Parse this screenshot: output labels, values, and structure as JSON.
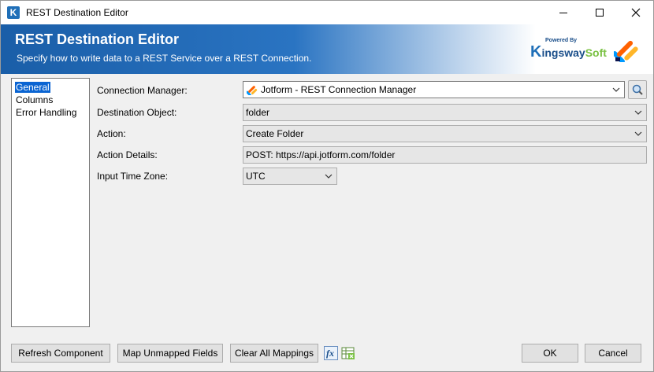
{
  "window": {
    "title": "REST Destination Editor",
    "icon": "kingsway-app-icon"
  },
  "header": {
    "title": "REST Destination Editor",
    "subtitle": "Specify how to write data to a REST Service over a REST Connection.",
    "brand_powered_by": "Powered By",
    "brand_k": "K",
    "brand_ingsway": "ingsway",
    "brand_soft": "Soft"
  },
  "nav": {
    "items": [
      {
        "label": "General",
        "selected": true
      },
      {
        "label": "Columns",
        "selected": false
      },
      {
        "label": "Error Handling",
        "selected": false
      }
    ]
  },
  "form": {
    "connection_manager": {
      "label": "Connection Manager:",
      "value": "Jotform - REST Connection Manager"
    },
    "destination_object": {
      "label": "Destination Object:",
      "value": "folder"
    },
    "action": {
      "label": "Action:",
      "value": "Create Folder"
    },
    "action_details": {
      "label": "Action Details:",
      "value": "POST: https://api.jotform.com/folder"
    },
    "input_time_zone": {
      "label": "Input Time Zone:",
      "value": "UTC"
    }
  },
  "buttons": {
    "refresh": "Refresh Component",
    "map_unmapped": "Map Unmapped Fields",
    "clear_mappings": "Clear All Mappings",
    "ok": "OK",
    "cancel": "Cancel"
  },
  "icons": {
    "fx": "fx",
    "lookup": "magnifier-icon"
  }
}
